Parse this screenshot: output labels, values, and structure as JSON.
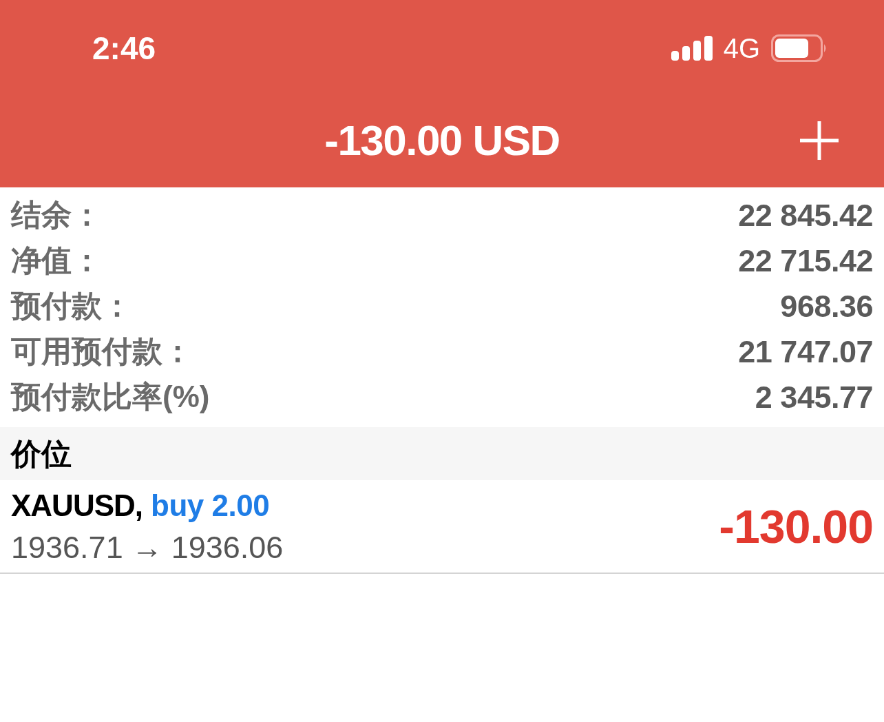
{
  "status_bar": {
    "time": "2:46",
    "network": "4G"
  },
  "header": {
    "title": "-130.00 USD"
  },
  "account": [
    {
      "label": "结余：",
      "value": "22 845.42"
    },
    {
      "label": "净值：",
      "value": "22 715.42"
    },
    {
      "label": "预付款：",
      "value": "968.36"
    },
    {
      "label": "可用预付款：",
      "value": "21 747.07"
    },
    {
      "label": "预付款比率(%)",
      "value": "2 345.77"
    }
  ],
  "section": {
    "title": "价位"
  },
  "positions": [
    {
      "symbol": "XAUUSD,",
      "order": "buy 2.00",
      "prices": "1936.71 → 1936.06",
      "profit": "-130.00"
    }
  ]
}
